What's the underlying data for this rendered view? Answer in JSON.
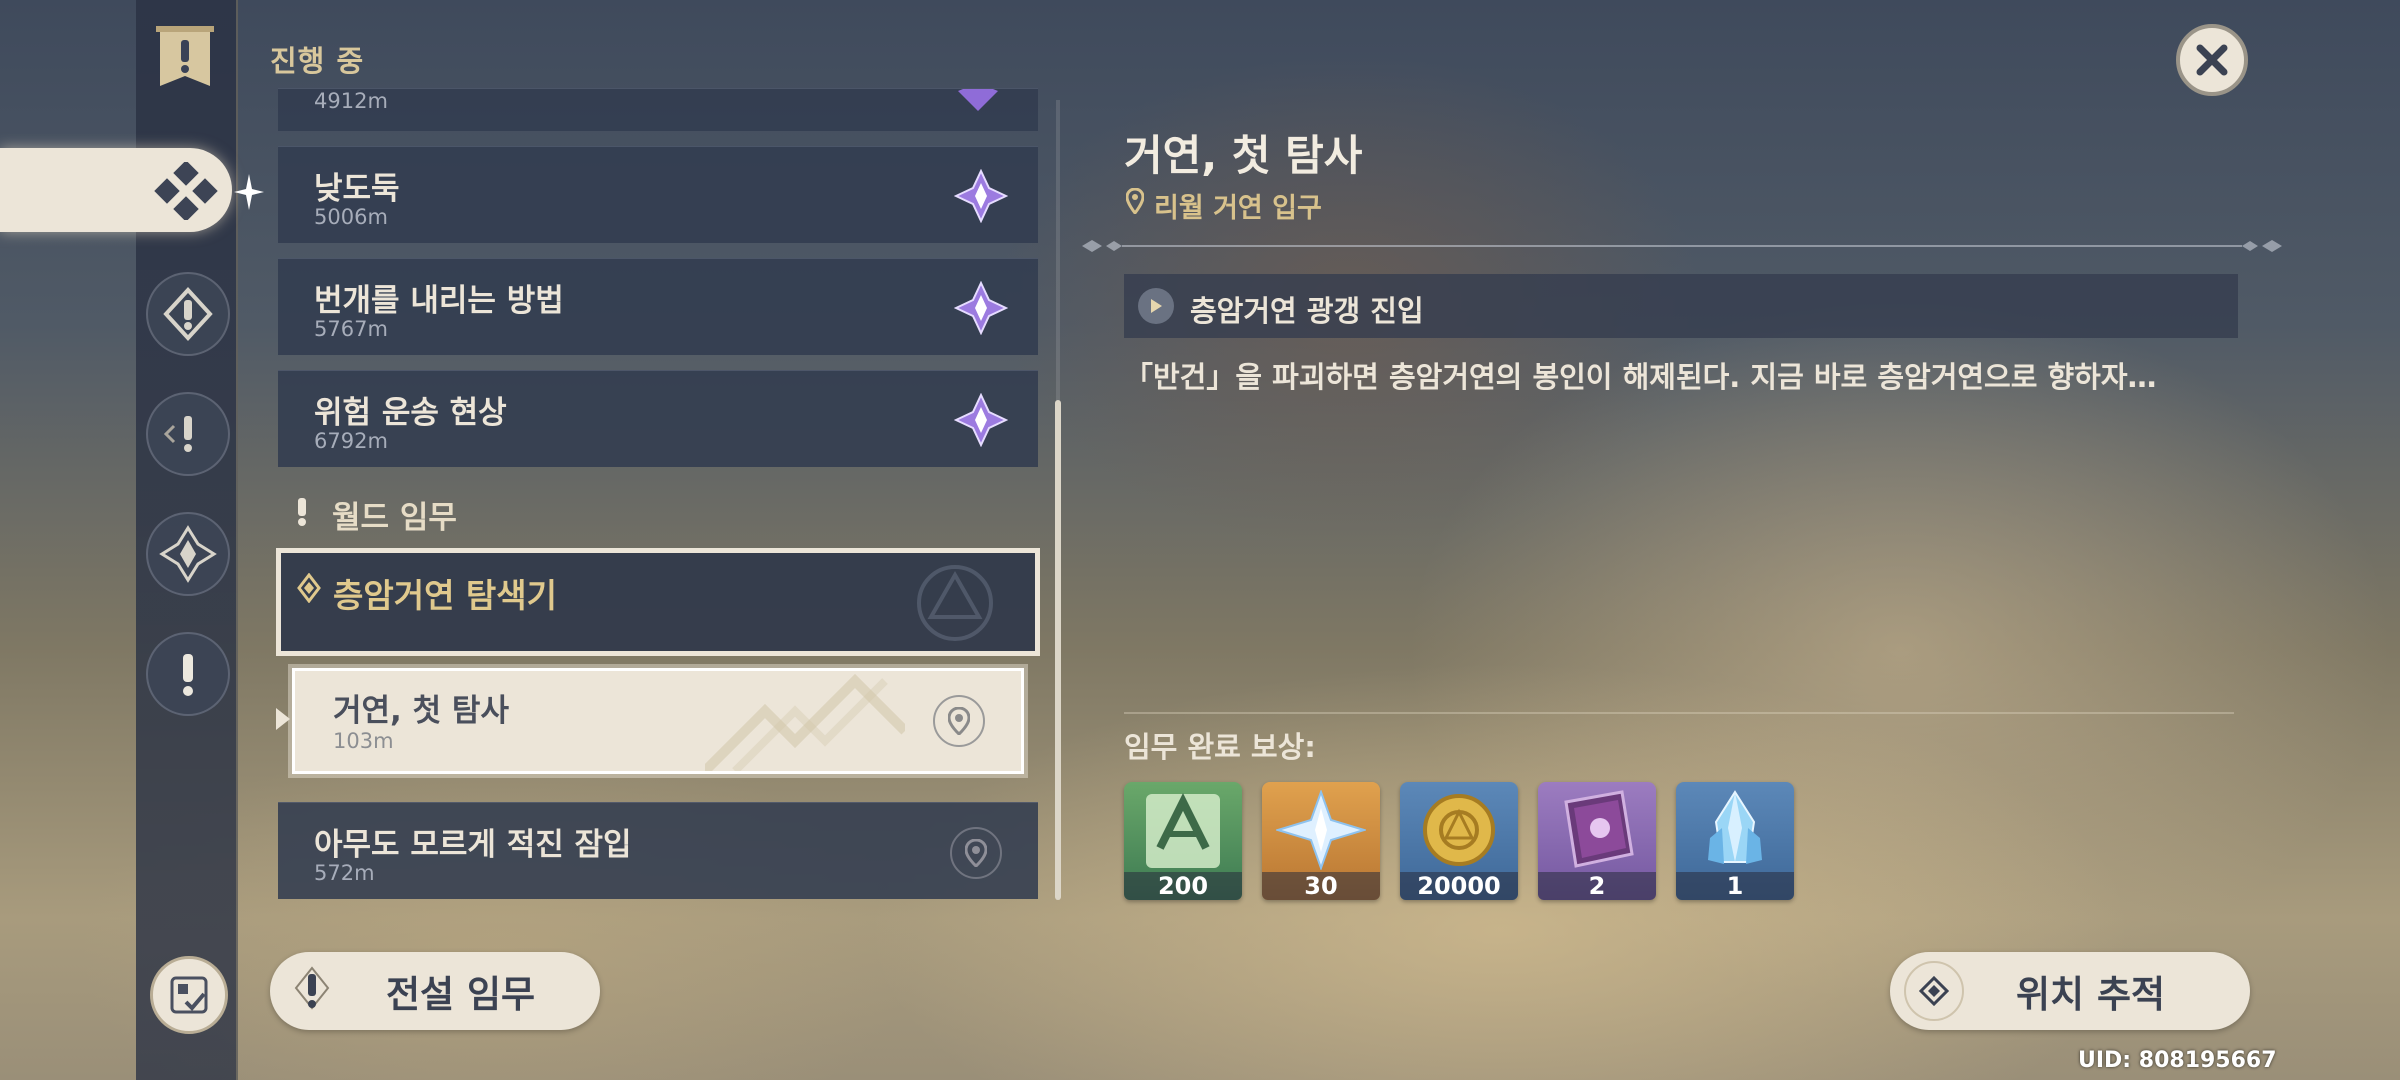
{
  "header": {
    "title": "진행 중"
  },
  "quests": {
    "partial": {
      "distance": "4912m"
    },
    "items": [
      {
        "name": "낮도둑",
        "distance": "5006m",
        "icon": "archon-quest-icon"
      },
      {
        "name": "번개를 내리는 방법",
        "distance": "5767m",
        "icon": "archon-quest-icon"
      },
      {
        "name": "위험 운송 현상",
        "distance": "6792m",
        "icon": "archon-quest-icon"
      }
    ]
  },
  "world_section": {
    "label": "월드 임무",
    "group_title": "층암거연 탐색기",
    "selected": {
      "name": "거연, 첫 탐사",
      "distance": "103m"
    },
    "next": {
      "name": "아무도 모르게 적진 잠입",
      "distance": "572m"
    }
  },
  "buttons": {
    "legend": "전설 임무",
    "track": "위치 추적"
  },
  "detail": {
    "title": "거연, 첫 탐사",
    "location": "리월 거연 입구",
    "step": "층암거연 광갱 진입",
    "description": "「반건」을 파괴하면 층암거연의 봉인이 해제된다. 지금 바로 층암거연으로 향하자…",
    "reward_label": "임무 완료 보상:",
    "rewards": [
      {
        "count": "200",
        "icon": "adventure-exp-icon",
        "color": "#5a9a5e"
      },
      {
        "count": "30",
        "icon": "primogem-icon",
        "color": "#c68a3e"
      },
      {
        "count": "20000",
        "icon": "mora-icon",
        "color": "#4e78a8"
      },
      {
        "count": "2",
        "icon": "heros-wit-book-icon",
        "color": "#8a6aa8"
      },
      {
        "count": "1",
        "icon": "mystic-ore-icon",
        "color": "#4e78a8"
      }
    ]
  },
  "uid": "UID: 808195667",
  "colors": {
    "accent_gold": "#d8c28c",
    "panel_cream": "#ece5d8",
    "panel_dark": "#323c50"
  }
}
